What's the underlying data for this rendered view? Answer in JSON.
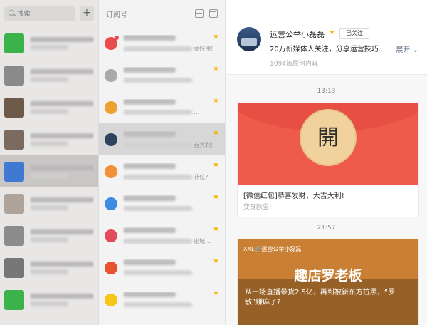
{
  "left": {
    "search_placeholder": "搜索",
    "plus_label": "+",
    "chats": [
      {
        "color": "#3bb34a"
      },
      {
        "color": "#8a8a8a"
      },
      {
        "color": "#6e5a48"
      },
      {
        "color": "#7d6a5f"
      },
      {
        "color": "#3f79d1",
        "active": true
      },
      {
        "color": "#b0a49a"
      },
      {
        "color": "#8c8c8c"
      },
      {
        "color": "#777777"
      },
      {
        "color": "#3bb34a"
      }
    ]
  },
  "middle": {
    "title": "订阅号",
    "items": [
      {
        "color": "#e94c4c",
        "dot": true,
        "tail": "要好用!",
        "starred": true
      },
      {
        "color": "#aaaaaa",
        "dot": false,
        "tail": "",
        "starred": true
      },
      {
        "color": "#f0a030",
        "dot": false,
        "tail": "…",
        "starred": true
      },
      {
        "color": "#2c4460",
        "dot": false,
        "tail": "吉大利!",
        "starred": true,
        "active": true
      },
      {
        "color": "#f29236",
        "dot": false,
        "tail": "补位?",
        "starred": true
      },
      {
        "color": "#3d8be0",
        "dot": false,
        "tail": "…",
        "starred": true
      },
      {
        "color": "#e24b5a",
        "dot": false,
        "tail": "座城…",
        "starred": true
      },
      {
        "color": "#e9522f",
        "dot": false,
        "tail": "…",
        "starred": true
      },
      {
        "color": "#f5c518",
        "dot": false,
        "tail": "…",
        "starred": true
      }
    ]
  },
  "window": {
    "pin": "⊥",
    "minimize": "—",
    "maximize": "□",
    "close": "✕"
  },
  "profile": {
    "name": "运营公举小磊磊",
    "follow_label": "已关注",
    "description": "20万新媒体人关注，分享运营技巧...",
    "expand_label": "展开",
    "article_count": "1094篇原创内容"
  },
  "messages": [
    {
      "time": "13:13",
      "coin_text": "開",
      "title": "[微信红包]恭喜发财，大吉大利!",
      "subtitle": "变身欧皇! !"
    },
    {
      "time": "21:57",
      "brand": "XXL🔗运营公举小磊磊",
      "big_text": "趣店罗老板",
      "title": "从一场直播带货2.5亿，再到被新东方拉黑，“罗敏”赚麻了?"
    }
  ],
  "colors": {
    "star": "#f6b400",
    "red_packet": "#ef5b4b",
    "expand_link": "#5b6b85"
  }
}
